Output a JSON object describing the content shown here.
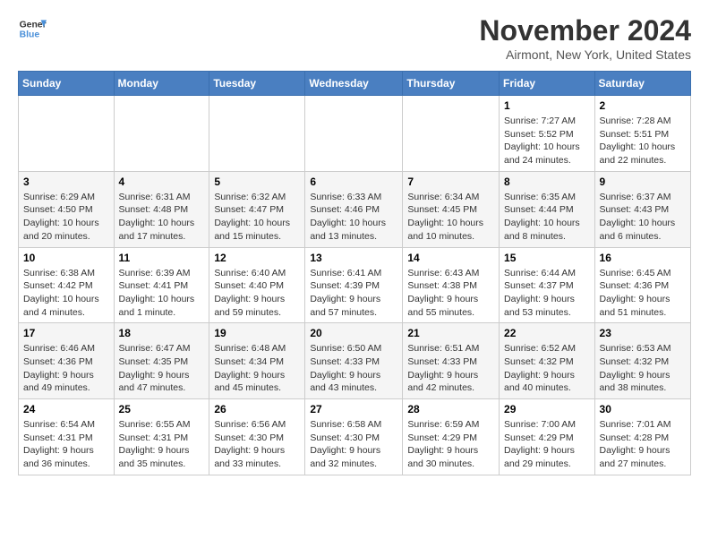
{
  "header": {
    "logo_line1": "General",
    "logo_line2": "Blue",
    "month": "November 2024",
    "location": "Airmont, New York, United States"
  },
  "weekdays": [
    "Sunday",
    "Monday",
    "Tuesday",
    "Wednesday",
    "Thursday",
    "Friday",
    "Saturday"
  ],
  "weeks": [
    [
      {
        "day": "",
        "info": ""
      },
      {
        "day": "",
        "info": ""
      },
      {
        "day": "",
        "info": ""
      },
      {
        "day": "",
        "info": ""
      },
      {
        "day": "",
        "info": ""
      },
      {
        "day": "1",
        "info": "Sunrise: 7:27 AM\nSunset: 5:52 PM\nDaylight: 10 hours and 24 minutes."
      },
      {
        "day": "2",
        "info": "Sunrise: 7:28 AM\nSunset: 5:51 PM\nDaylight: 10 hours and 22 minutes."
      }
    ],
    [
      {
        "day": "3",
        "info": "Sunrise: 6:29 AM\nSunset: 4:50 PM\nDaylight: 10 hours and 20 minutes."
      },
      {
        "day": "4",
        "info": "Sunrise: 6:31 AM\nSunset: 4:48 PM\nDaylight: 10 hours and 17 minutes."
      },
      {
        "day": "5",
        "info": "Sunrise: 6:32 AM\nSunset: 4:47 PM\nDaylight: 10 hours and 15 minutes."
      },
      {
        "day": "6",
        "info": "Sunrise: 6:33 AM\nSunset: 4:46 PM\nDaylight: 10 hours and 13 minutes."
      },
      {
        "day": "7",
        "info": "Sunrise: 6:34 AM\nSunset: 4:45 PM\nDaylight: 10 hours and 10 minutes."
      },
      {
        "day": "8",
        "info": "Sunrise: 6:35 AM\nSunset: 4:44 PM\nDaylight: 10 hours and 8 minutes."
      },
      {
        "day": "9",
        "info": "Sunrise: 6:37 AM\nSunset: 4:43 PM\nDaylight: 10 hours and 6 minutes."
      }
    ],
    [
      {
        "day": "10",
        "info": "Sunrise: 6:38 AM\nSunset: 4:42 PM\nDaylight: 10 hours and 4 minutes."
      },
      {
        "day": "11",
        "info": "Sunrise: 6:39 AM\nSunset: 4:41 PM\nDaylight: 10 hours and 1 minute."
      },
      {
        "day": "12",
        "info": "Sunrise: 6:40 AM\nSunset: 4:40 PM\nDaylight: 9 hours and 59 minutes."
      },
      {
        "day": "13",
        "info": "Sunrise: 6:41 AM\nSunset: 4:39 PM\nDaylight: 9 hours and 57 minutes."
      },
      {
        "day": "14",
        "info": "Sunrise: 6:43 AM\nSunset: 4:38 PM\nDaylight: 9 hours and 55 minutes."
      },
      {
        "day": "15",
        "info": "Sunrise: 6:44 AM\nSunset: 4:37 PM\nDaylight: 9 hours and 53 minutes."
      },
      {
        "day": "16",
        "info": "Sunrise: 6:45 AM\nSunset: 4:36 PM\nDaylight: 9 hours and 51 minutes."
      }
    ],
    [
      {
        "day": "17",
        "info": "Sunrise: 6:46 AM\nSunset: 4:36 PM\nDaylight: 9 hours and 49 minutes."
      },
      {
        "day": "18",
        "info": "Sunrise: 6:47 AM\nSunset: 4:35 PM\nDaylight: 9 hours and 47 minutes."
      },
      {
        "day": "19",
        "info": "Sunrise: 6:48 AM\nSunset: 4:34 PM\nDaylight: 9 hours and 45 minutes."
      },
      {
        "day": "20",
        "info": "Sunrise: 6:50 AM\nSunset: 4:33 PM\nDaylight: 9 hours and 43 minutes."
      },
      {
        "day": "21",
        "info": "Sunrise: 6:51 AM\nSunset: 4:33 PM\nDaylight: 9 hours and 42 minutes."
      },
      {
        "day": "22",
        "info": "Sunrise: 6:52 AM\nSunset: 4:32 PM\nDaylight: 9 hours and 40 minutes."
      },
      {
        "day": "23",
        "info": "Sunrise: 6:53 AM\nSunset: 4:32 PM\nDaylight: 9 hours and 38 minutes."
      }
    ],
    [
      {
        "day": "24",
        "info": "Sunrise: 6:54 AM\nSunset: 4:31 PM\nDaylight: 9 hours and 36 minutes."
      },
      {
        "day": "25",
        "info": "Sunrise: 6:55 AM\nSunset: 4:31 PM\nDaylight: 9 hours and 35 minutes."
      },
      {
        "day": "26",
        "info": "Sunrise: 6:56 AM\nSunset: 4:30 PM\nDaylight: 9 hours and 33 minutes."
      },
      {
        "day": "27",
        "info": "Sunrise: 6:58 AM\nSunset: 4:30 PM\nDaylight: 9 hours and 32 minutes."
      },
      {
        "day": "28",
        "info": "Sunrise: 6:59 AM\nSunset: 4:29 PM\nDaylight: 9 hours and 30 minutes."
      },
      {
        "day": "29",
        "info": "Sunrise: 7:00 AM\nSunset: 4:29 PM\nDaylight: 9 hours and 29 minutes."
      },
      {
        "day": "30",
        "info": "Sunrise: 7:01 AM\nSunset: 4:28 PM\nDaylight: 9 hours and 27 minutes."
      }
    ]
  ]
}
